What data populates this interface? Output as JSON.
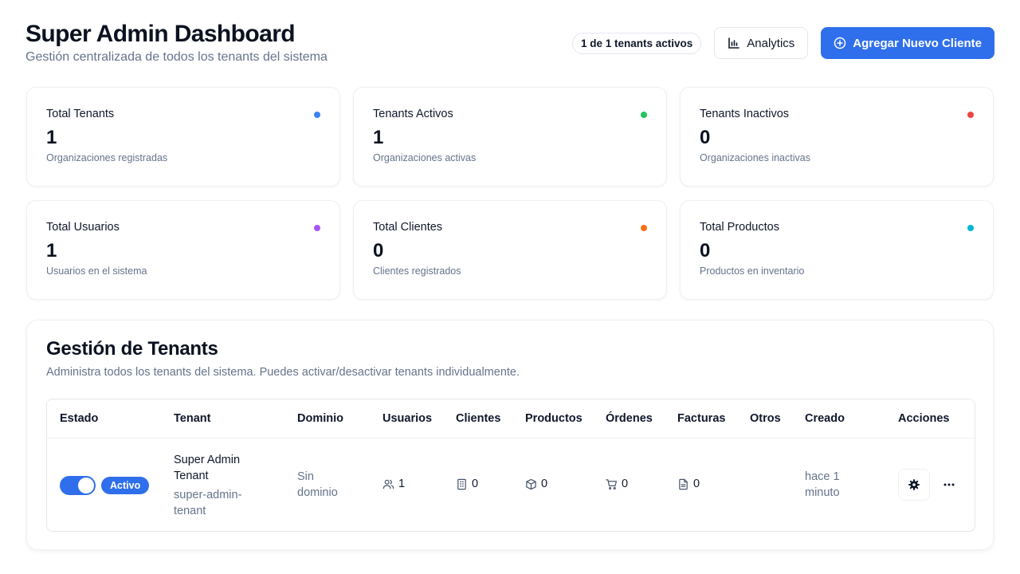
{
  "header": {
    "title": "Super Admin Dashboard",
    "subtitle": "Gestión centralizada de todos los tenants del sistema",
    "active_pill": "1 de 1 tenants activos",
    "analytics_label": "Analytics",
    "add_client_label": "Agregar Nuevo Cliente"
  },
  "stats": [
    {
      "title": "Total Tenants",
      "value": "1",
      "desc": "Organizaciones registradas",
      "color": "#3b82f6"
    },
    {
      "title": "Tenants Activos",
      "value": "1",
      "desc": "Organizaciones activas",
      "color": "#22c55e"
    },
    {
      "title": "Tenants Inactivos",
      "value": "0",
      "desc": "Organizaciones inactivas",
      "color": "#ef4444"
    },
    {
      "title": "Total Usuarios",
      "value": "1",
      "desc": "Usuarios en el sistema",
      "color": "#a855f7"
    },
    {
      "title": "Total Clientes",
      "value": "0",
      "desc": "Clientes registrados",
      "color": "#f97316"
    },
    {
      "title": "Total Productos",
      "value": "0",
      "desc": "Productos en inventario",
      "color": "#06b6d4"
    }
  ],
  "tenants_panel": {
    "title": "Gestión de Tenants",
    "subtitle": "Administra todos los tenants del sistema. Puedes activar/desactivar tenants individualmente.",
    "columns": [
      "Estado",
      "Tenant",
      "Dominio",
      "Usuarios",
      "Clientes",
      "Productos",
      "Órdenes",
      "Facturas",
      "Otros",
      "Creado",
      "Acciones"
    ],
    "rows": [
      {
        "status_label": "Activo",
        "status_on": true,
        "tenant_name_line1": "Super Admin",
        "tenant_name_line2": "Tenant",
        "tenant_slug_line1": "super-admin-",
        "tenant_slug_line2": "tenant",
        "domain_line1": "Sin",
        "domain_line2": "dominio",
        "users": "1",
        "clients": "0",
        "products": "0",
        "orders": "0",
        "invoices": "0",
        "others": "",
        "created_line1": "hace 1",
        "created_line2": "minuto"
      }
    ]
  }
}
